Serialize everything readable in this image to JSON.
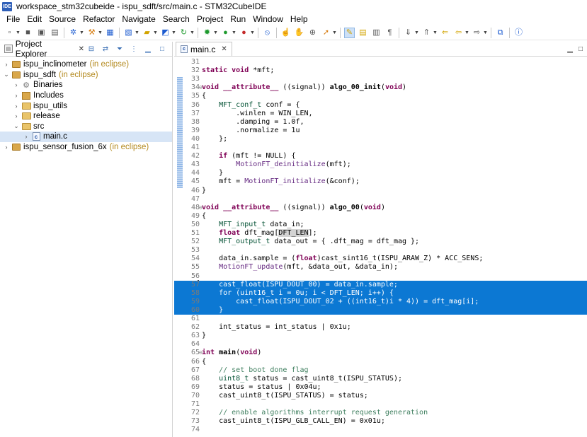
{
  "window": {
    "app_icon": "IDE",
    "title": "workspace_stm32cubeide - ispu_sdft/src/main.c - STM32CubeIDE"
  },
  "menu": [
    "File",
    "Edit",
    "Source",
    "Refactor",
    "Navigate",
    "Search",
    "Project",
    "Run",
    "Window",
    "Help"
  ],
  "explorer": {
    "title": "Project Explorer",
    "close": "✕",
    "tree": [
      {
        "indent": 0,
        "twisty": "›",
        "icon": "project",
        "label": "ispu_inclinometer",
        "suffix": "(in eclipse)"
      },
      {
        "indent": 0,
        "twisty": "⌄",
        "icon": "project",
        "label": "ispu_sdft",
        "suffix": "(in eclipse)"
      },
      {
        "indent": 1,
        "twisty": "›",
        "icon": "binaries",
        "label": "Binaries",
        "suffix": ""
      },
      {
        "indent": 1,
        "twisty": "›",
        "icon": "includes",
        "label": "Includes",
        "suffix": ""
      },
      {
        "indent": 1,
        "twisty": "›",
        "icon": "folder",
        "label": "ispu_utils",
        "suffix": ""
      },
      {
        "indent": 1,
        "twisty": "›",
        "icon": "folder",
        "label": "release",
        "suffix": ""
      },
      {
        "indent": 1,
        "twisty": "⌄",
        "icon": "src",
        "label": "src",
        "suffix": ""
      },
      {
        "indent": 2,
        "twisty": "›",
        "icon": "cfile",
        "label": "main.c",
        "suffix": "",
        "selected": true
      },
      {
        "indent": 0,
        "twisty": "›",
        "icon": "project",
        "label": "ispu_sensor_fusion_6x",
        "suffix": "(in eclipse)"
      }
    ]
  },
  "editor": {
    "tab_label": "main.c",
    "tab_close": "✕",
    "file_icon_letter": "c",
    "lines": [
      {
        "n": "31",
        "html": ""
      },
      {
        "n": "32",
        "html": "<span class=\"kw\">static void</span> *mft;"
      },
      {
        "n": "33",
        "html": ""
      },
      {
        "n": "34",
        "fold": "⊖",
        "html": "<span class=\"kw\">void</span> <span class=\"kw\">__attribute__</span> ((signal)) <span class=\"fnb\">algo_00_init</span>(<span class=\"kw\">void</span>)"
      },
      {
        "n": "35",
        "html": "{"
      },
      {
        "n": "36",
        "html": "    <span class=\"ty\">MFT_conf_t</span> conf = {"
      },
      {
        "n": "37",
        "html": "        .winlen = WIN_LEN,"
      },
      {
        "n": "38",
        "html": "        .damping = 1.0f,"
      },
      {
        "n": "39",
        "html": "        .normalize = 1u"
      },
      {
        "n": "40",
        "html": "    };"
      },
      {
        "n": "41",
        "html": ""
      },
      {
        "n": "42",
        "html": "    <span class=\"kw\">if</span> (mft != NULL) {"
      },
      {
        "n": "43",
        "html": "        <span class=\"fn\">MotionFT_deinitialize</span>(mft);"
      },
      {
        "n": "44",
        "html": "    }"
      },
      {
        "n": "45",
        "html": "    mft = <span class=\"fn\">MotionFT_initialize</span>(&amp;conf);"
      },
      {
        "n": "46",
        "html": "}"
      },
      {
        "n": "47",
        "html": ""
      },
      {
        "n": "48",
        "fold": "⊖",
        "html": "<span class=\"kw\">void</span> <span class=\"kw\">__attribute__</span> ((signal)) <span class=\"fnb\">algo_00</span>(<span class=\"kw\">void</span>)"
      },
      {
        "n": "49",
        "html": "{"
      },
      {
        "n": "50",
        "html": "    <span class=\"ty\">MFT_input_t</span> data_in;"
      },
      {
        "n": "51",
        "html": "    <span class=\"kw\">float</span> dft_mag[<span class=\"hl\">DFT_LEN</span>];"
      },
      {
        "n": "52",
        "html": "    <span class=\"ty\">MFT_output_t</span> data_out = { .dft_mag = dft_mag };"
      },
      {
        "n": "53",
        "html": ""
      },
      {
        "n": "54",
        "html": "    data_in.sample = (<span class=\"kw\">float</span>)cast_sint16_t(ISPU_ARAW_Z) * ACC_SENS;"
      },
      {
        "n": "55",
        "html": "    <span class=\"fn\">MotionFT_update</span>(mft, &amp;data_out, &amp;data_in);"
      },
      {
        "n": "56",
        "html": ""
      },
      {
        "n": "57",
        "sel": true,
        "html": "    cast_float(ISPU_DOUT_00) = data_in.sample;"
      },
      {
        "n": "58",
        "sel": true,
        "html": "    for (uint16_t i = 0u; i &lt; DFT_LEN; i++) {"
      },
      {
        "n": "59",
        "sel": true,
        "html": "        cast_float(ISPU_DOUT_02 + ((int16_t)i * 4)) = dft_mag[i];"
      },
      {
        "n": "60",
        "sel": true,
        "html": "    }"
      },
      {
        "n": "61",
        "html": ""
      },
      {
        "n": "62",
        "html": "    int_status = int_status | 0x1u;"
      },
      {
        "n": "63",
        "html": "}"
      },
      {
        "n": "64",
        "html": ""
      },
      {
        "n": "65",
        "fold": "⊖",
        "html": "<span class=\"kw\">int</span> <span class=\"fnb\">main</span>(<span class=\"kw\">void</span>)"
      },
      {
        "n": "66",
        "html": "{"
      },
      {
        "n": "67",
        "html": "    <span class=\"cm\">// set boot done flag</span>"
      },
      {
        "n": "68",
        "html": "    <span class=\"ty\">uint8_t</span> status = cast_uint8_t(ISPU_STATUS);"
      },
      {
        "n": "69",
        "html": "    status = status | 0x04u;"
      },
      {
        "n": "70",
        "html": "    cast_uint8_t(ISPU_STATUS) = status;"
      },
      {
        "n": "71",
        "html": ""
      },
      {
        "n": "72",
        "html": "    <span class=\"cm\">// enable algorithms interrupt request generation</span>"
      },
      {
        "n": "73",
        "html": "    cast_uint8_t(ISPU_GLB_CALL_EN) = 0x01u;"
      },
      {
        "n": "74",
        "html": ""
      }
    ]
  }
}
